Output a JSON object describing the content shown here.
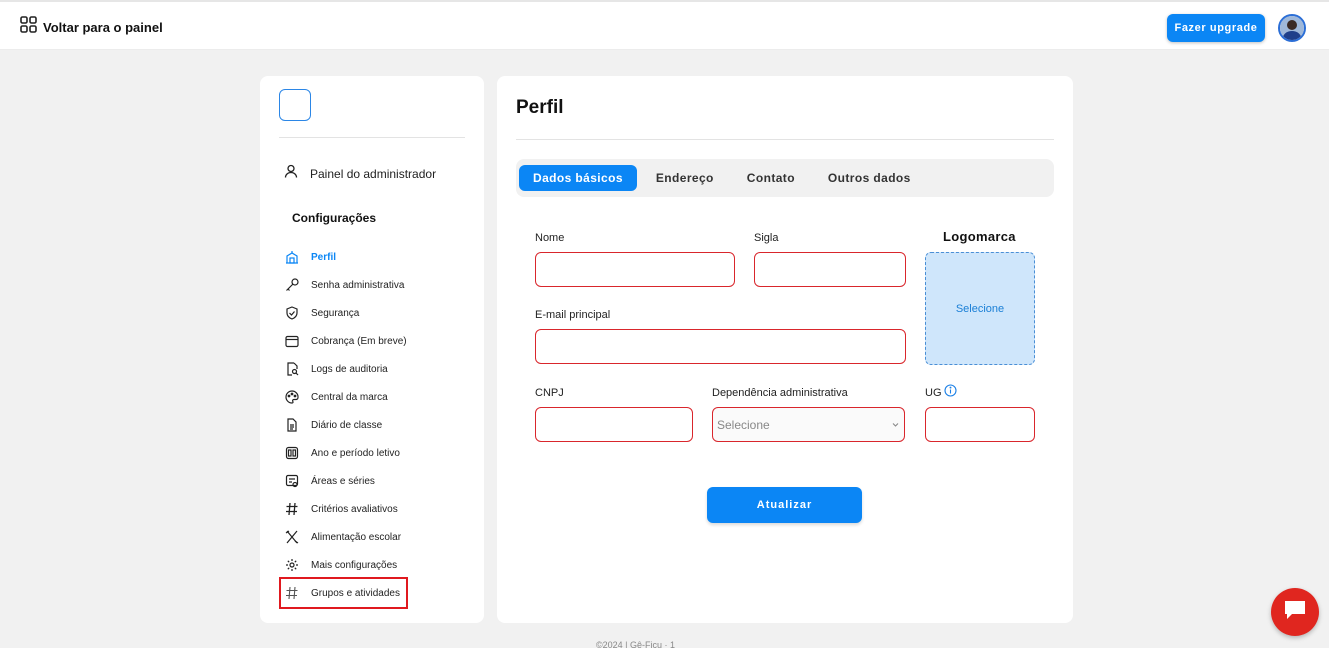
{
  "topbar": {
    "back_label": "Voltar para o painel",
    "upgrade_label": "Fazer upgrade"
  },
  "sidebar": {
    "admin_label": "Painel do administrador",
    "section_title": "Configurações",
    "items": [
      {
        "label": "Perfil",
        "icon": "building-icon",
        "active": true
      },
      {
        "label": "Senha administrativa",
        "icon": "key-icon"
      },
      {
        "label": "Segurança",
        "icon": "shield-icon"
      },
      {
        "label": "Cobrança (Em breve)",
        "icon": "wallet-icon"
      },
      {
        "label": "Logs de auditoria",
        "icon": "document-search-icon"
      },
      {
        "label": "Central da marca",
        "icon": "palette-icon"
      },
      {
        "label": "Diário de classe",
        "icon": "document-icon"
      },
      {
        "label": "Ano e período letivo",
        "icon": "calendar-icon"
      },
      {
        "label": "Áreas e séries",
        "icon": "list-icon"
      },
      {
        "label": "Critérios avaliativos",
        "icon": "hash-icon"
      },
      {
        "label": "Alimentação escolar",
        "icon": "cutlery-icon"
      },
      {
        "label": "Mais configurações",
        "icon": "gear-icon"
      },
      {
        "label": "Grupos e atividades",
        "icon": "hash-icon",
        "highlighted": true
      }
    ]
  },
  "main": {
    "title": "Perfil",
    "tabs": [
      {
        "label": "Dados básicos",
        "active": true
      },
      {
        "label": "Endereço"
      },
      {
        "label": "Contato"
      },
      {
        "label": "Outros dados"
      }
    ],
    "form": {
      "nome_label": "Nome",
      "sigla_label": "Sigla",
      "email_label": "E-mail principal",
      "cnpj_label": "CNPJ",
      "dependencia_label": "Dependência administrativa",
      "dependencia_value": "Selecione",
      "ug_label": "UG",
      "logomarca_label": "Logomarca",
      "logomarca_select": "Selecione",
      "update_label": "Atualizar"
    }
  },
  "footer": {
    "text": "©2024 | Gê-Ficu · 1"
  },
  "colors": {
    "accent": "#0b86f5",
    "error_border": "#d9262c",
    "upload_bg": "#cfe6fb",
    "chat": "#e0261f"
  }
}
